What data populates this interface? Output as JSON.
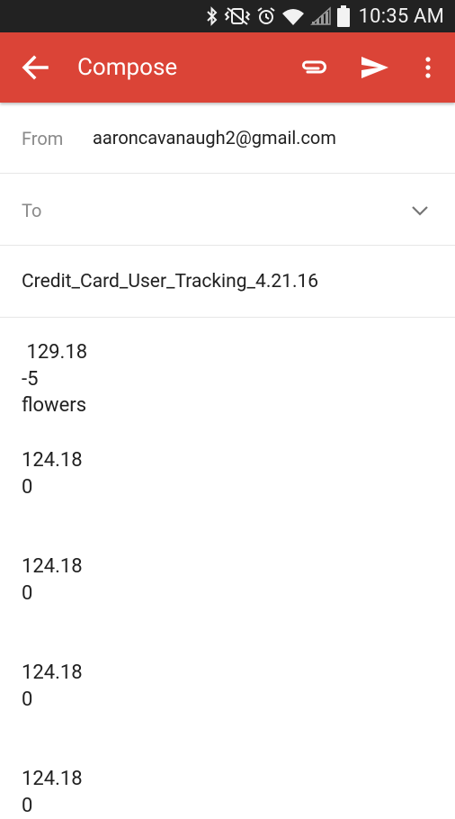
{
  "status_bar": {
    "time": "10:35 AM",
    "icons": [
      "bluetooth-icon",
      "vibrate-icon",
      "alarm-icon",
      "wifi-icon",
      "signal-icon",
      "battery-icon"
    ]
  },
  "app_bar": {
    "title": "Compose",
    "color": "#db4437",
    "actions": [
      "attach-icon",
      "send-icon",
      "more-vert-icon"
    ]
  },
  "from": {
    "label": "From",
    "value": "aaroncavanaugh2@gmail.com"
  },
  "to": {
    "label": "To",
    "value": ""
  },
  "subject": {
    "value": "Credit_Card_User_Tracking_4.21.16"
  },
  "body": {
    "blocks": [
      {
        "lines": [
          " 129.18",
          "-5",
          "flowers"
        ]
      },
      {
        "lines": [
          "124.18",
          "0"
        ]
      },
      {
        "lines": [
          "124.18",
          "0"
        ]
      },
      {
        "lines": [
          "124.18",
          "0"
        ]
      },
      {
        "lines": [
          "124.18",
          "0"
        ]
      }
    ]
  }
}
